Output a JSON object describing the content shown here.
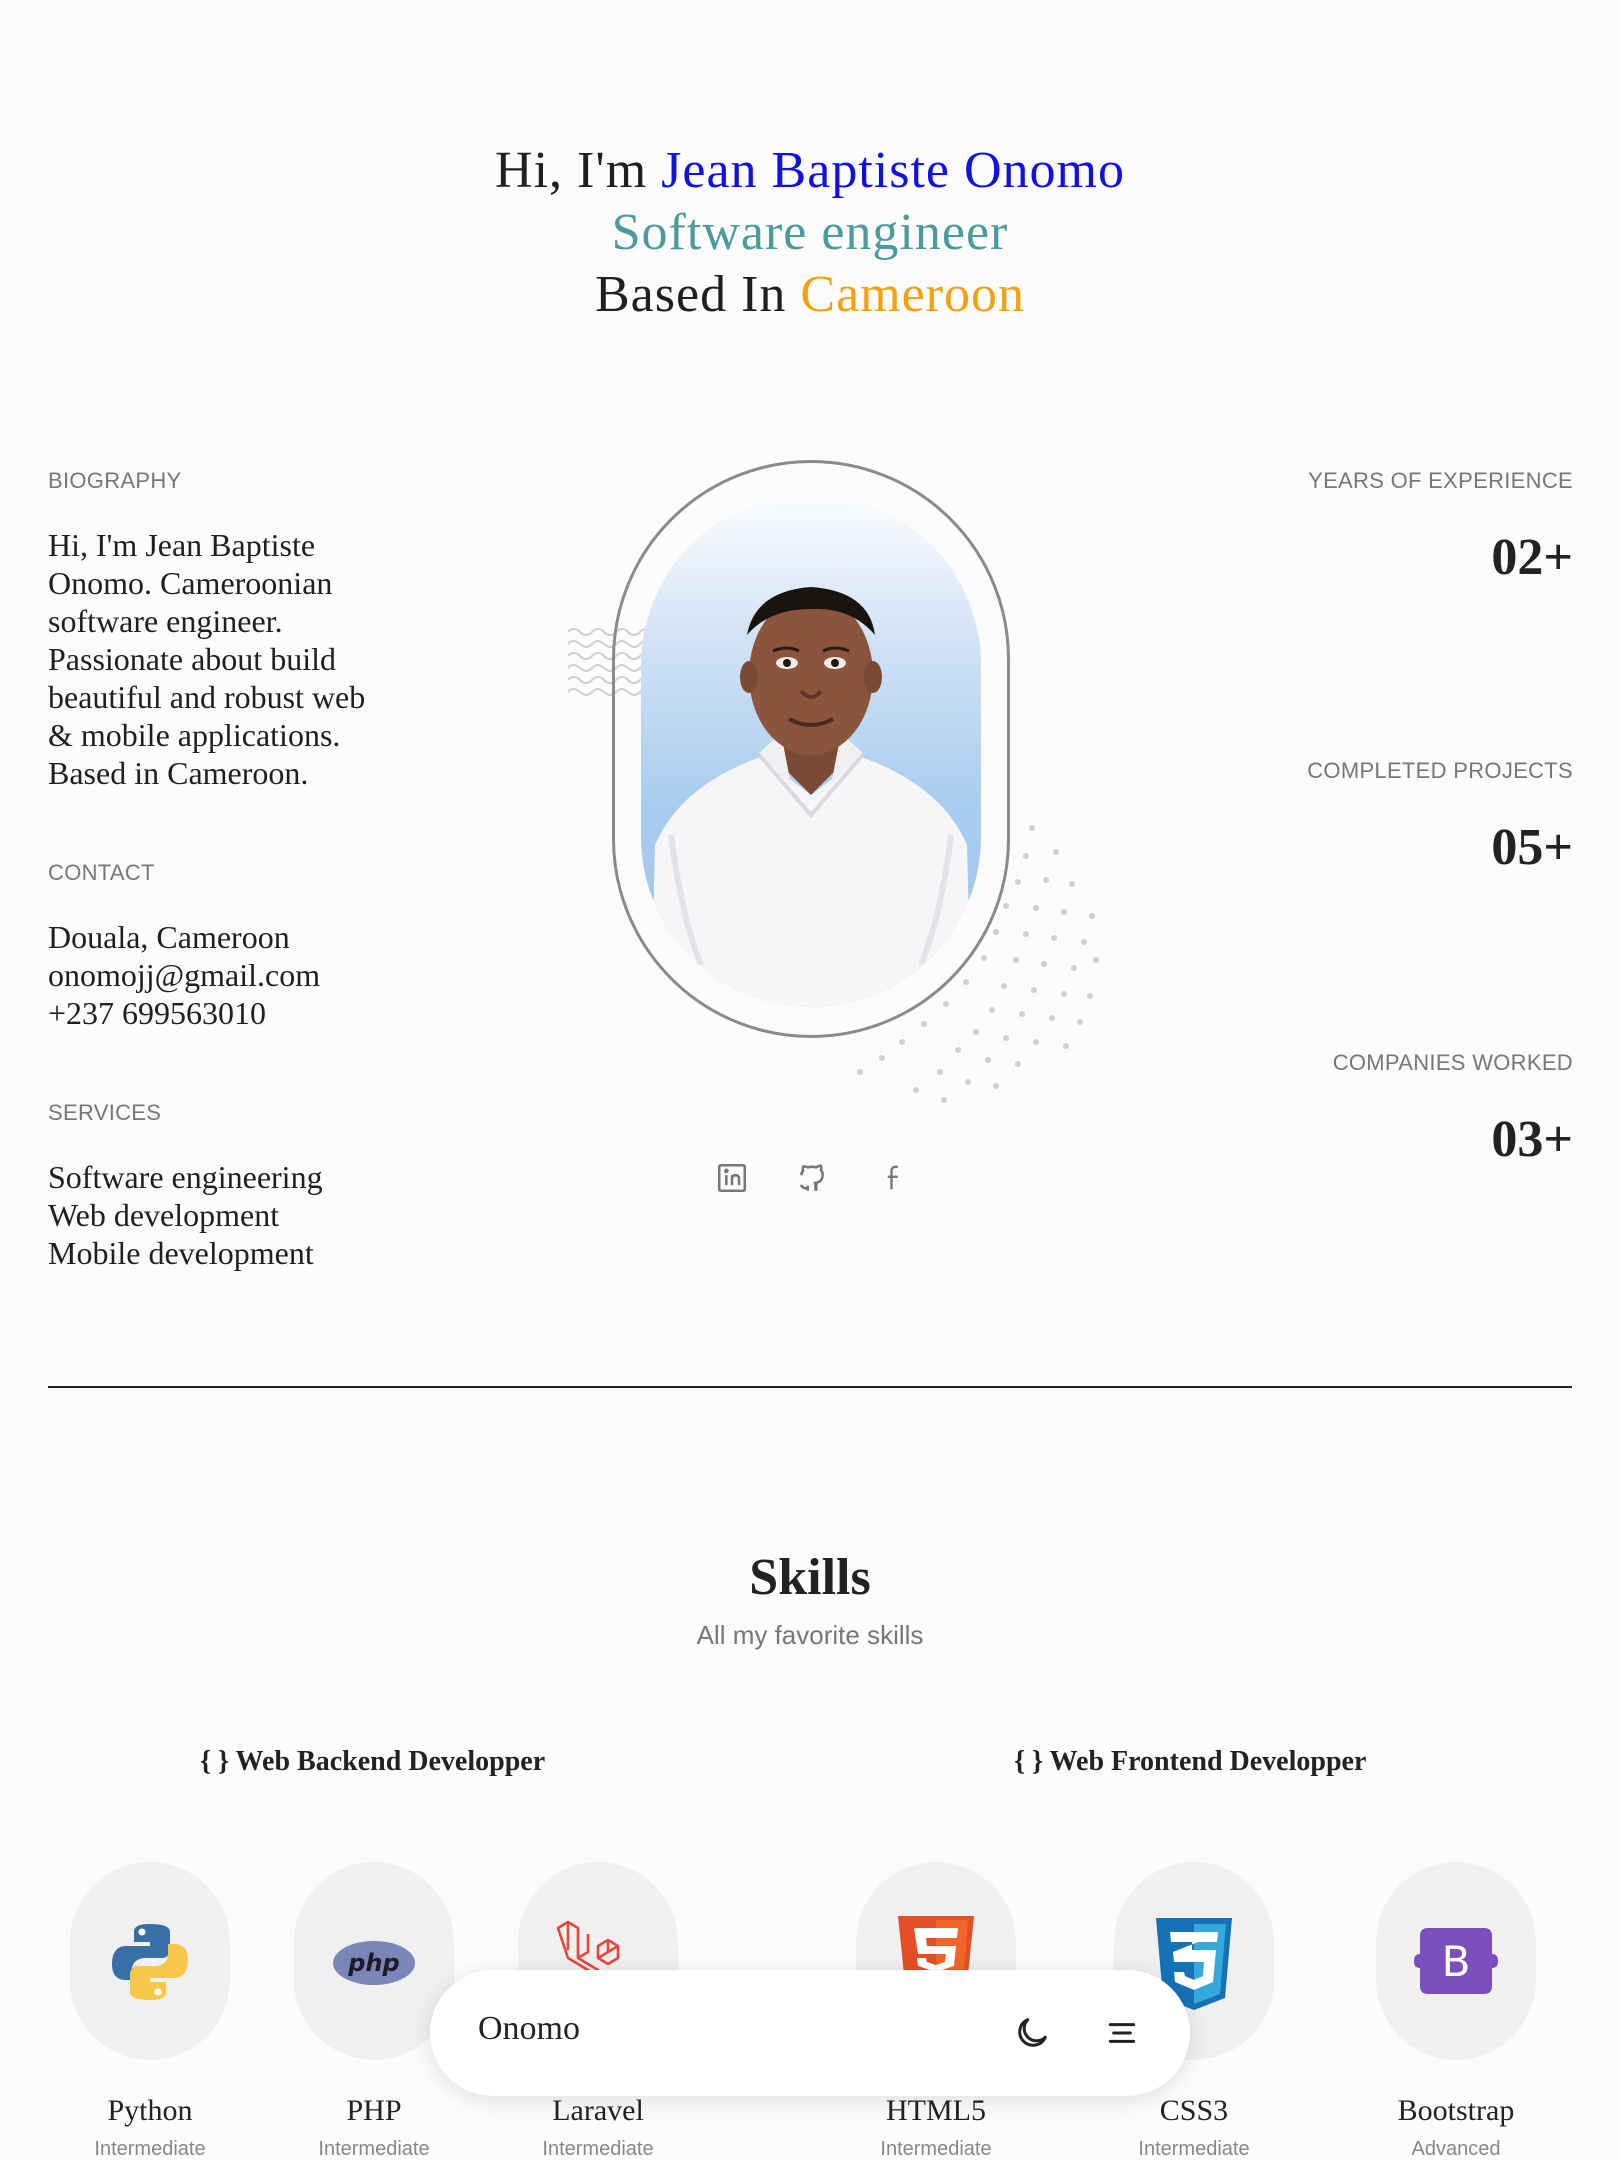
{
  "hero": {
    "greeting": "Hi, I'm ",
    "name": "Jean Baptiste Onomo",
    "role": "Software engineer",
    "based_prefix": "Based In ",
    "country": "Cameroon"
  },
  "colors": {
    "name": "#1010e6",
    "role": "#4b9a9c",
    "country": "#f5a00e"
  },
  "biography": {
    "label": "BIOGRAPHY",
    "lines": [
      "Hi, I'm Jean Baptiste",
      "Onomo. Cameroonian",
      "software engineer.",
      "Passionate about build",
      "beautiful and robust web",
      "& mobile applications.",
      "Based in Cameroon."
    ]
  },
  "contact": {
    "label": "CONTACT",
    "lines": [
      "Douala, Cameroon",
      "onomojj@gmail.com",
      "+237 699563010"
    ]
  },
  "services": {
    "label": "SERVICES",
    "lines": [
      "Software engineering",
      "Web development",
      "Mobile development"
    ]
  },
  "stats": [
    {
      "label": "YEARS OF EXPERIENCE",
      "value": "02+"
    },
    {
      "label": "COMPLETED PROJECTS",
      "value": "05+"
    },
    {
      "label": "COMPANIES WORKED",
      "value": "03+"
    }
  ],
  "social": [
    "linkedin-icon",
    "github-icon",
    "facebook-icon"
  ],
  "skills": {
    "title": "Skills",
    "subtitle": "All my favorite skills",
    "categories": [
      "{ } Web Backend Developper",
      "{ } Web Frontend Developper"
    ],
    "items": [
      {
        "name": "Python",
        "level": "Intermediate",
        "icon": "python-icon"
      },
      {
        "name": "PHP",
        "level": "Intermediate",
        "icon": "php-icon"
      },
      {
        "name": "Laravel",
        "level": "Intermediate",
        "icon": "laravel-icon"
      },
      {
        "name": "HTML5",
        "level": "Intermediate",
        "icon": "html5-icon"
      },
      {
        "name": "CSS3",
        "level": "Intermediate",
        "icon": "css3-icon"
      },
      {
        "name": "Bootstrap",
        "level": "Advanced",
        "icon": "bootstrap-icon"
      }
    ]
  },
  "navbar": {
    "brand": "Onomo",
    "icons": [
      "moon-icon",
      "menu-icon"
    ]
  }
}
